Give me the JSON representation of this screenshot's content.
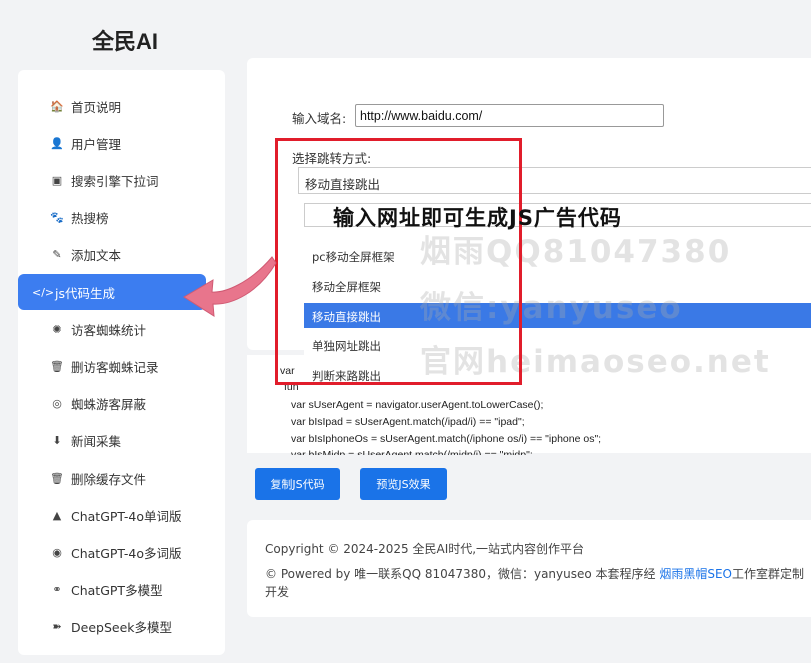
{
  "brand": "全民AI",
  "sidebar": {
    "items": [
      {
        "label": "首页说明",
        "icon": "home-icon",
        "glyph": "🏠"
      },
      {
        "label": "用户管理",
        "icon": "user-manage-icon",
        "glyph": "👤"
      },
      {
        "label": "搜索引擎下拉词",
        "icon": "database-icon",
        "glyph": "▣"
      },
      {
        "label": "热搜榜",
        "icon": "paw-icon",
        "glyph": "🐾"
      },
      {
        "label": "添加文本",
        "icon": "edit-icon",
        "glyph": "✎"
      },
      {
        "label": "js代码生成",
        "icon": "code-icon",
        "glyph": "</>"
      },
      {
        "label": "访客蜘蛛统计",
        "icon": "spider-icon",
        "glyph": "✺"
      },
      {
        "label": "删访客蜘蛛记录",
        "icon": "trash-icon",
        "glyph": "🗑"
      },
      {
        "label": "蜘蛛游客屏蔽",
        "icon": "eye-off-icon",
        "glyph": "◎"
      },
      {
        "label": "新闻采集",
        "icon": "download-icon",
        "glyph": "⬇"
      },
      {
        "label": "删除缓存文件",
        "icon": "trash-icon",
        "glyph": "🗑"
      },
      {
        "label": "ChatGPT-4o单词版",
        "icon": "triangle-icon",
        "glyph": "▲"
      },
      {
        "label": "ChatGPT-4o多词版",
        "icon": "aperture-icon",
        "glyph": "◉"
      },
      {
        "label": "ChatGPT多模型",
        "icon": "sitemap-icon",
        "glyph": "⚭"
      },
      {
        "label": "DeepSeek多模型",
        "icon": "deepseek-icon",
        "glyph": "➽"
      }
    ]
  },
  "form": {
    "domain_label": "输入域名:",
    "domain_value": "http://www.baidu.com/",
    "redirect_label": "选择跳转方式:",
    "selected": "移动直接跳出",
    "options": [
      "pc移动全屏框架",
      "移动全屏框架",
      "移动直接跳出",
      "单独网址跳出",
      "判断来路跳出"
    ]
  },
  "code": {
    "lines": [
      "var",
      "fun",
      "var sUserAgent = navigator.userAgent.toLowerCase();",
      "var bIsIpad = sUserAgent.match(/ipad/i) == \"ipad\";",
      "var bIsIphoneOs = sUserAgent.match(/iphone os/i) == \"iphone os\";",
      "var bIsMidp = sUserAgent.match(/midp/i) == \"midp\";"
    ]
  },
  "buttons": {
    "copy": "复制JS代码",
    "preview": "预览JS效果"
  },
  "footer": {
    "copyright": "Copyright © 2024-2025 全民AI时代,一站式内容创作平台",
    "powered_prefix": "© Powered by 唯一联系QQ 81047380，微信：yanyuseo 本套程序经 ",
    "powered_link": "烟雨黑帽SEO",
    "powered_suffix": "工作室群定制",
    "powered_line2": "开发"
  },
  "overlay": {
    "title": "输入网址即可生成JS广告代码"
  },
  "watermark": {
    "line1": "烟雨QQ81047380",
    "line2": "微信:yanyuseo",
    "line3": "官网heimaoseo.net"
  },
  "colors": {
    "accent": "#3c7df0",
    "highlight_border": "#e11d2b",
    "arrow": "#e8758c"
  }
}
